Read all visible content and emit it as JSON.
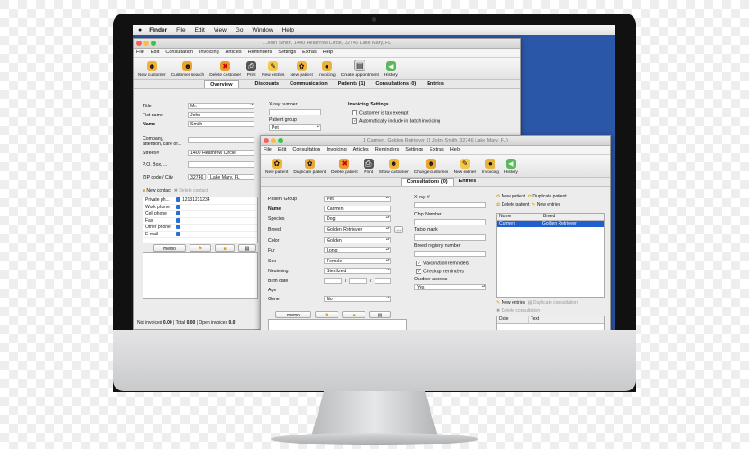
{
  "menubar": {
    "apple": "",
    "items": [
      "Finder",
      "File",
      "Edit",
      "View",
      "Go",
      "Window",
      "Help"
    ]
  },
  "win1": {
    "title": "1 John Smith, 1400 Heathrow Circle, 32746 Lake Mary, FL",
    "menu": [
      "File",
      "Edit",
      "Consultation",
      "Invoicing",
      "Articles",
      "Reminders",
      "Settings",
      "Extras",
      "Help"
    ],
    "toolbar": [
      "New customer",
      "Customer search",
      "Delete customer",
      "Print",
      "New entries",
      "New patient",
      "Invoicing",
      "Create appointment",
      "History"
    ],
    "tabs": [
      "Overview",
      "",
      "Discounts",
      "Communication",
      "Patients (1)",
      "Consultations (0)",
      "Entries"
    ],
    "form": {
      "title_label": "Title",
      "title_value": "Mr.",
      "first_name_label": "Fist name",
      "first_name_value": "John",
      "name_label": "Name",
      "name_value": "Smith",
      "company_label": "Company,\nattention, care of...",
      "street_label": "Street/#",
      "street_value": "1400 Heathrow Circle",
      "pobox_label": "P.O. Box, ...",
      "zip_label": "ZIP code / City",
      "zip_value": "32746",
      "city_value": "Lake Mary, FL",
      "xray_label": "X-ray number",
      "patient_group_label": "Patient group",
      "patient_group_value": "Pet",
      "invoicing_settings": "Invoicing Settings",
      "tax_exempt": "Customer is tax exempt",
      "batch_invoicing": "Automatically include in batch invoicing"
    },
    "contact": {
      "new_contact": "New contact",
      "delete_contact": "Delete contact",
      "rows": [
        {
          "label": "Private ph...",
          "value": "12131231234"
        },
        {
          "label": "Work phone",
          "value": ""
        },
        {
          "label": "Cell phone",
          "value": ""
        },
        {
          "label": "Fax",
          "value": ""
        },
        {
          "label": "Other phone",
          "value": ""
        },
        {
          "label": "E-mail",
          "value": ""
        }
      ]
    },
    "memo": "memo",
    "status": {
      "not_invoiced_label": "Not invoiced",
      "not_invoiced_value": "0.00",
      "total_label": "| Total",
      "total_value": "0.00",
      "open_invoices": "| Open invoices",
      "open_value": "0.0"
    }
  },
  "win2": {
    "title": "1 Carmen, Golden Retriever (1 John Smith, 32746 Lake Mary, FL)",
    "menu": [
      "File",
      "Edit",
      "Consultation",
      "Invoicing",
      "Articles",
      "Reminders",
      "Settings",
      "Extras",
      "Help"
    ],
    "toolbar": [
      "New patient",
      "Duplicate patient",
      "Delete patient",
      "Print",
      "Show customer",
      "Change customer",
      "New entries",
      "Invoicing",
      "History"
    ],
    "tabs": [
      "",
      "Consultations (0)",
      "Entries"
    ],
    "form": {
      "patient_group_label": "Patient Group",
      "patient_group_value": "Pet",
      "name_label": "Name",
      "name_value": "Carmen",
      "species_label": "Species",
      "species_value": "Dog",
      "breed_label": "Breed",
      "breed_value": "Golden Retriever",
      "breed_more": "...",
      "color_label": "Color",
      "color_value": "Golden",
      "fur_label": "Fur",
      "fur_value": "Long",
      "sex_label": "Sex",
      "sex_value": "Female",
      "neutering_label": "Neutering",
      "neutering_value": "Sterilized",
      "birth_label": "Birth date",
      "age_label": "Age",
      "gone_label": "Gone",
      "gone_value": "No",
      "xray_label": "X-ray #",
      "chip_label": "Chip Number",
      "tattoo_label": "Tatoo mark",
      "breed_reg_label": "Breed registry number",
      "vaccination": "Vaccination reminders",
      "checkup": "Checkup reminders",
      "outdoor_label": "Outdoor access",
      "outdoor_value": "Yes"
    },
    "patients_panel": {
      "new_patient": "New patient",
      "duplicate_patient": "Duplicate patient",
      "delete_patient": "Delete patient",
      "new_entries": "New entries",
      "col_name": "Name",
      "col_breed": "Breed",
      "row_name": "Carmen",
      "row_breed": "Golden Retriever"
    },
    "consult_panel": {
      "new_entries": "New entries",
      "duplicate": "Duplicate consultation",
      "delete": "Delete consultation",
      "col_date": "Date",
      "col_text": "Text"
    },
    "memo": "memo"
  },
  "colors": {
    "desktop": "#2b57a8",
    "selection": "#1f5fcf",
    "window": "#ececec"
  }
}
